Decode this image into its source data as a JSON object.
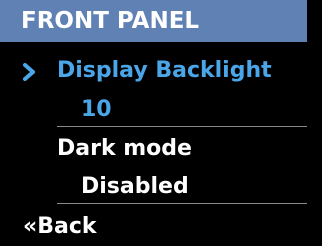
{
  "colors": {
    "header_bg": "#5f81b4",
    "background": "#000000",
    "selected_text": "#4aa6e8",
    "normal_text": "#ffffff",
    "divider": "#8a8a8a"
  },
  "header": {
    "title": "FRONT PANEL"
  },
  "menu": {
    "selected_indicator_icon": "chevron-right-icon",
    "items": [
      {
        "label": "Display Backlight",
        "value": "10",
        "selected": true
      },
      {
        "label": "Dark mode",
        "value": "Disabled",
        "selected": false
      }
    ]
  },
  "footer": {
    "back_label": "«Back"
  }
}
